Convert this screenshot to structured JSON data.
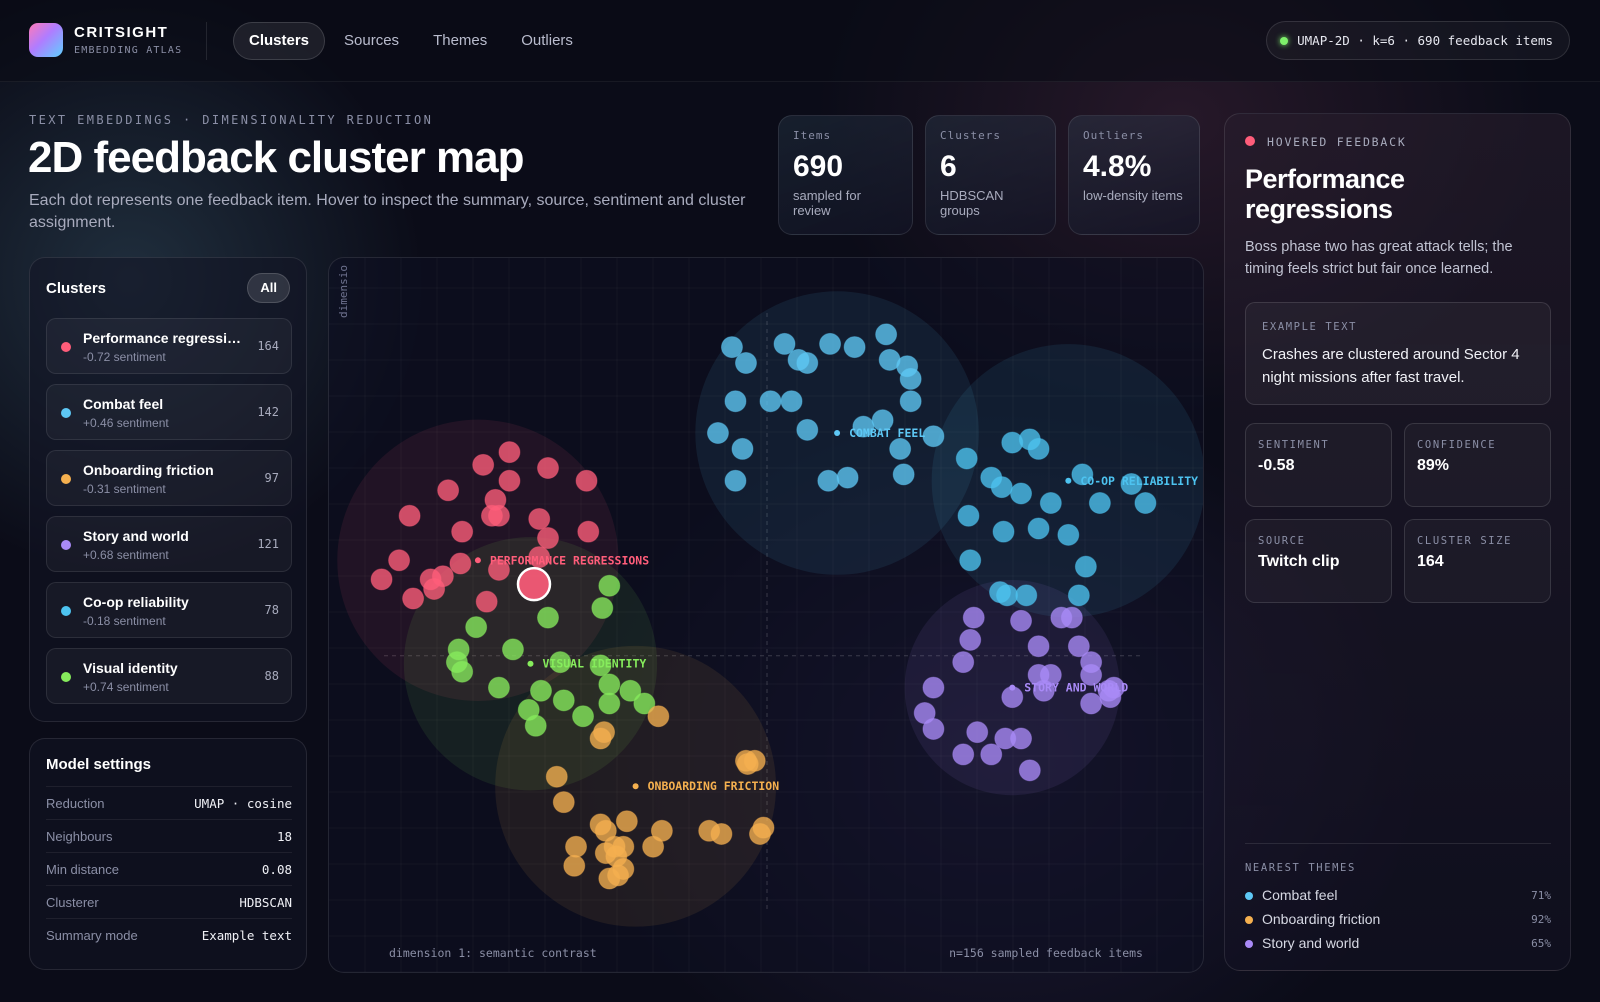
{
  "brand": {
    "name": "CRITSIGHT",
    "subtitle": "EMBEDDING ATLAS"
  },
  "nav": {
    "tabs": [
      "Clusters",
      "Sources",
      "Themes",
      "Outliers"
    ],
    "active": "Clusters"
  },
  "status": {
    "text": "UMAP-2D · k=6 · 690 feedback items",
    "color": "#7ef06b"
  },
  "header": {
    "eyebrow": "TEXT EMBEDDINGS · DIMENSIONALITY REDUCTION",
    "title": "2D feedback cluster map",
    "description": "Each dot represents one feedback item. Hover to inspect the summary, source, sentiment and cluster assignment."
  },
  "stats": [
    {
      "label": "Items",
      "value": "690",
      "caption": "sampled for review"
    },
    {
      "label": "Clusters",
      "value": "6",
      "caption": "HDBSCAN groups"
    },
    {
      "label": "Outliers",
      "value": "4.8%",
      "caption": "low-density items"
    }
  ],
  "clusters_panel": {
    "title": "Clusters",
    "filter_label": "All",
    "items": [
      {
        "name": "Performance regressions",
        "sentiment": "-0.72 sentiment",
        "count": "164",
        "color": "#ff5d7a"
      },
      {
        "name": "Combat feel",
        "sentiment": "+0.46 sentiment",
        "count": "142",
        "color": "#5ec8f5"
      },
      {
        "name": "Onboarding friction",
        "sentiment": "-0.31 sentiment",
        "count": "97",
        "color": "#f5b04f"
      },
      {
        "name": "Story and world",
        "sentiment": "+0.68 sentiment",
        "count": "121",
        "color": "#a98af7"
      },
      {
        "name": "Co-op reliability",
        "sentiment": "-0.18 sentiment",
        "count": "78",
        "color": "#4dc3f0"
      },
      {
        "name": "Visual identity",
        "sentiment": "+0.74 sentiment",
        "count": "88",
        "color": "#86ec5c"
      }
    ]
  },
  "model_settings": {
    "title": "Model settings",
    "rows": [
      {
        "label": "Reduction",
        "value": "UMAP · cosine"
      },
      {
        "label": "Neighbours",
        "value": "18"
      },
      {
        "label": "Min distance",
        "value": "0.08"
      },
      {
        "label": "Clusterer",
        "value": "HDBSCAN"
      },
      {
        "label": "Summary mode",
        "value": "Example text"
      }
    ]
  },
  "plot": {
    "y_axis_label": "dimensio",
    "x_axis_label": "dimension 1: semantic contrast",
    "footer_note": "n=156 sampled feedback items"
  },
  "chart_data": {
    "type": "scatter",
    "note": "UMAP projection, unitless axes; points estimated from the screenshot",
    "series": [
      {
        "name": "PERFORMANCE REGRESSIONS",
        "color": "#ff5d7a",
        "centroid": [
          -1.65,
          0.6
        ],
        "points": [
          [
            -1.62,
            1.2
          ],
          [
            -1.47,
            1.1
          ],
          [
            -1.25,
            1.18
          ],
          [
            -1.47,
            1.28
          ],
          [
            -1.03,
            1.1
          ],
          [
            -1.82,
            1.04
          ],
          [
            -1.55,
            0.98
          ],
          [
            -2.04,
            0.88
          ],
          [
            -1.57,
            0.88
          ],
          [
            -1.74,
            0.78
          ],
          [
            -1.3,
            0.86
          ],
          [
            -1.25,
            0.74
          ],
          [
            -1.02,
            0.78
          ],
          [
            -2.1,
            0.6
          ],
          [
            -1.75,
            0.58
          ],
          [
            -1.53,
            0.54
          ],
          [
            -1.3,
            0.62
          ],
          [
            -2.2,
            0.48
          ],
          [
            -1.9,
            0.42
          ],
          [
            -1.92,
            0.48
          ],
          [
            -2.02,
            0.36
          ],
          [
            -1.6,
            0.34
          ],
          [
            -1.53,
            0.88
          ],
          [
            -1.85,
            0.5
          ]
        ]
      },
      {
        "name": "COMBAT FEEL",
        "color": "#5ec8f5",
        "centroid": [
          0.4,
          1.4
        ],
        "points": [
          [
            -0.2,
            1.94
          ],
          [
            -0.12,
            1.84
          ],
          [
            0.1,
            1.96
          ],
          [
            0.18,
            1.86
          ],
          [
            0.23,
            1.84
          ],
          [
            0.36,
            1.96
          ],
          [
            0.5,
            1.94
          ],
          [
            0.7,
            1.86
          ],
          [
            0.68,
            2.02
          ],
          [
            0.8,
            1.82
          ],
          [
            0.82,
            1.74
          ],
          [
            -0.18,
            1.6
          ],
          [
            0.02,
            1.6
          ],
          [
            0.14,
            1.6
          ],
          [
            -0.28,
            1.4
          ],
          [
            0.23,
            1.42
          ],
          [
            0.55,
            1.44
          ],
          [
            0.66,
            1.48
          ],
          [
            0.82,
            1.6
          ],
          [
            0.95,
            1.38
          ],
          [
            0.76,
            1.3
          ],
          [
            0.35,
            1.1
          ],
          [
            -0.14,
            1.3
          ],
          [
            0.46,
            1.12
          ],
          [
            0.78,
            1.14
          ],
          [
            -0.18,
            1.1
          ]
        ]
      },
      {
        "name": "CO-OP RELIABILITY",
        "color": "#4dc3f0",
        "centroid": [
          1.72,
          1.1
        ],
        "points": [
          [
            1.4,
            1.34
          ],
          [
            1.5,
            1.36
          ],
          [
            1.55,
            1.3
          ],
          [
            1.14,
            1.24
          ],
          [
            1.28,
            1.12
          ],
          [
            1.8,
            1.14
          ],
          [
            2.08,
            1.08
          ],
          [
            1.34,
            1.06
          ],
          [
            1.45,
            1.02
          ],
          [
            1.62,
            0.96
          ],
          [
            1.9,
            0.96
          ],
          [
            2.16,
            0.96
          ],
          [
            1.15,
            0.88
          ],
          [
            1.35,
            0.78
          ],
          [
            1.72,
            0.76
          ],
          [
            1.55,
            0.8
          ],
          [
            1.16,
            0.6
          ],
          [
            1.82,
            0.56
          ],
          [
            1.33,
            0.4
          ],
          [
            1.37,
            0.38
          ],
          [
            1.48,
            0.38
          ],
          [
            1.78,
            0.38
          ]
        ]
      },
      {
        "name": "VISUAL IDENTITY",
        "color": "#86ec5c",
        "centroid": [
          -1.35,
          -0.05
        ],
        "points": [
          [
            -0.9,
            0.44
          ],
          [
            -0.94,
            0.3
          ],
          [
            -1.25,
            0.24
          ],
          [
            -1.66,
            0.18
          ],
          [
            -1.76,
            0.04
          ],
          [
            -1.77,
            -0.04
          ],
          [
            -1.45,
            0.04
          ],
          [
            -1.18,
            -0.04
          ],
          [
            -0.95,
            -0.06
          ],
          [
            -1.74,
            -0.1
          ],
          [
            -0.9,
            -0.18
          ],
          [
            -1.53,
            -0.2
          ],
          [
            -1.29,
            -0.22
          ],
          [
            -0.78,
            -0.22
          ],
          [
            -1.16,
            -0.28
          ],
          [
            -1.36,
            -0.34
          ],
          [
            -0.9,
            -0.3
          ],
          [
            -1.32,
            -0.44
          ],
          [
            -1.05,
            -0.38
          ],
          [
            -0.7,
            -0.3
          ]
        ]
      },
      {
        "name": "ONBOARDING FRICTION",
        "color": "#f5b04f",
        "centroid": [
          -0.75,
          -0.82
        ],
        "points": [
          [
            -0.62,
            -0.38
          ],
          [
            -0.95,
            -0.52
          ],
          [
            -0.93,
            -0.48
          ],
          [
            -0.12,
            -0.66
          ],
          [
            -0.11,
            -0.68
          ],
          [
            -0.07,
            -0.66
          ],
          [
            -1.2,
            -0.76
          ],
          [
            -1.16,
            -0.92
          ],
          [
            -0.95,
            -1.06
          ],
          [
            -0.8,
            -1.04
          ],
          [
            -0.6,
            -1.1
          ],
          [
            -0.92,
            -1.1
          ],
          [
            -0.33,
            -1.1
          ],
          [
            -0.02,
            -1.08
          ],
          [
            -0.26,
            -1.12
          ],
          [
            -0.04,
            -1.12
          ],
          [
            -1.09,
            -1.2
          ],
          [
            -0.87,
            -1.2
          ],
          [
            -0.82,
            -1.2
          ],
          [
            -0.92,
            -1.24
          ],
          [
            -0.86,
            -1.26
          ],
          [
            -0.65,
            -1.2
          ],
          [
            -1.1,
            -1.32
          ],
          [
            -0.82,
            -1.34
          ],
          [
            -0.85,
            -1.38
          ],
          [
            -0.9,
            -1.4
          ]
        ]
      },
      {
        "name": "STORY AND WORLD",
        "color": "#a98af7",
        "centroid": [
          1.4,
          -0.2
        ],
        "points": [
          [
            1.18,
            0.24
          ],
          [
            1.45,
            0.22
          ],
          [
            1.68,
            0.24
          ],
          [
            1.74,
            0.24
          ],
          [
            1.16,
            0.1
          ],
          [
            1.55,
            0.06
          ],
          [
            1.78,
            0.06
          ],
          [
            1.12,
            -0.04
          ],
          [
            1.85,
            -0.04
          ],
          [
            1.55,
            -0.12
          ],
          [
            1.62,
            -0.12
          ],
          [
            1.85,
            -0.12
          ],
          [
            0.95,
            -0.2
          ],
          [
            1.4,
            -0.26
          ],
          [
            1.58,
            -0.22
          ],
          [
            1.95,
            -0.22
          ],
          [
            1.98,
            -0.2
          ],
          [
            0.9,
            -0.36
          ],
          [
            1.85,
            -0.3
          ],
          [
            1.96,
            -0.26
          ],
          [
            0.95,
            -0.46
          ],
          [
            1.2,
            -0.48
          ],
          [
            1.36,
            -0.52
          ],
          [
            1.45,
            -0.52
          ],
          [
            1.28,
            -0.62
          ],
          [
            1.12,
            -0.62
          ],
          [
            1.5,
            -0.72
          ]
        ]
      }
    ],
    "highlighted_point": {
      "series": "PERFORMANCE REGRESSIONS",
      "x": -1.33,
      "y": 0.45
    },
    "xlim": [
      -2.5,
      2.5
    ],
    "ylim": [
      -2.0,
      2.5
    ],
    "xlabel": "dimension 1: semantic contrast",
    "ylabel": "dimensio",
    "grid": true,
    "legend": "none"
  },
  "detail": {
    "tag": "HOVERED FEEDBACK",
    "title": "Performance regressions",
    "summary": "Boss phase two has great attack tells; the timing feels strict but fair once learned.",
    "example_label": "EXAMPLE TEXT",
    "example_text": "Crashes are clustered around Sector 4 night missions after fast travel.",
    "metrics": [
      {
        "label": "SENTIMENT",
        "value": "-0.58"
      },
      {
        "label": "CONFIDENCE",
        "value": "89%"
      },
      {
        "label": "SOURCE",
        "value": "Twitch clip"
      },
      {
        "label": "CLUSTER SIZE",
        "value": "164"
      }
    ],
    "themes_label": "NEAREST THEMES",
    "themes": [
      {
        "name": "Combat feel",
        "pct": "71%",
        "color": "#5ec8f5"
      },
      {
        "name": "Onboarding friction",
        "pct": "92%",
        "color": "#f5b04f"
      },
      {
        "name": "Story and world",
        "pct": "65%",
        "color": "#a98af7"
      }
    ]
  }
}
